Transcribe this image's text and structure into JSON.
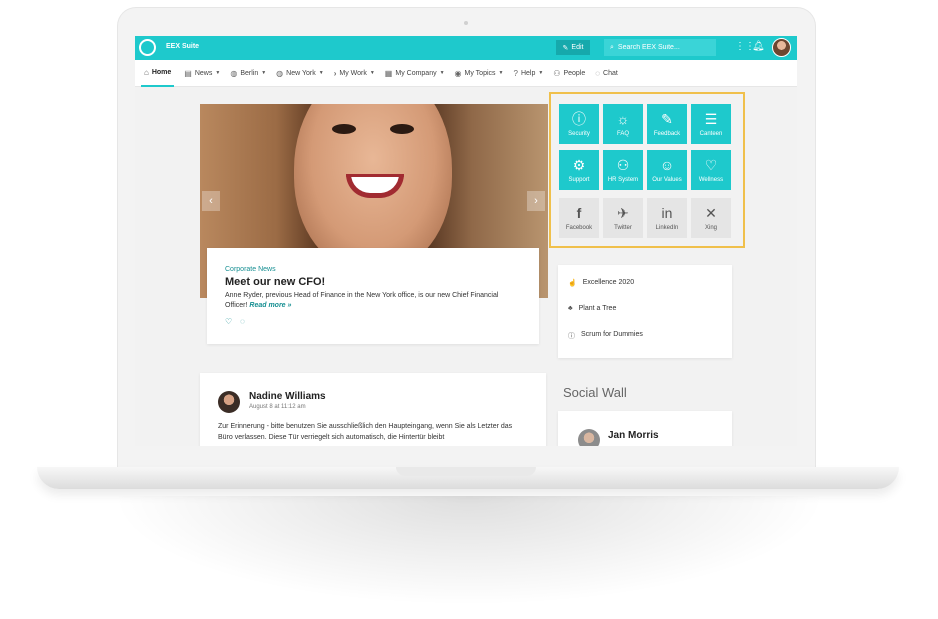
{
  "app": {
    "name": "EEX Suite"
  },
  "topbar": {
    "edit_label": "Edit",
    "search_placeholder": "Search EEX Suite..."
  },
  "nav": [
    {
      "label": "Home",
      "icon": "home-icon",
      "active": true
    },
    {
      "label": "News",
      "icon": "newspaper-icon",
      "dropdown": true
    },
    {
      "label": "Berlin",
      "icon": "location-pin-icon",
      "dropdown": true
    },
    {
      "label": "New York",
      "icon": "location-pin-icon",
      "dropdown": true
    },
    {
      "label": "My Work",
      "icon": "chevron-right-icon",
      "dropdown": true
    },
    {
      "label": "My Company",
      "icon": "building-icon",
      "dropdown": true
    },
    {
      "label": "My Topics",
      "icon": "eye-icon",
      "dropdown": true
    },
    {
      "label": "Help",
      "icon": "question-icon",
      "dropdown": true
    },
    {
      "label": "People",
      "icon": "people-icon"
    },
    {
      "label": "Chat",
      "icon": "chat-icon"
    }
  ],
  "hero": {
    "category": "Corporate News",
    "title": "Meet our new CFO!",
    "text": "Anne Ryder, previous Head of Finance in the New York office, is our new Chief Financial Officer!",
    "read_more": "Read more »"
  },
  "tiles": [
    {
      "label": "Security",
      "icon": "info-icon",
      "color": "#1ec9cc"
    },
    {
      "label": "FAQ",
      "icon": "lightbulb-icon",
      "color": "#1ec9cc"
    },
    {
      "label": "Feedback",
      "icon": "edit-icon",
      "color": "#1ec9cc"
    },
    {
      "label": "Canteen",
      "icon": "burger-icon",
      "color": "#1ec9cc"
    },
    {
      "label": "Support",
      "icon": "gear-icon",
      "color": "#1ec9cc"
    },
    {
      "label": "HR System",
      "icon": "team-icon",
      "color": "#1ec9cc"
    },
    {
      "label": "Our Values",
      "icon": "smile-icon",
      "color": "#1ec9cc"
    },
    {
      "label": "Wellness",
      "icon": "heart-icon",
      "color": "#1ec9cc"
    },
    {
      "label": "Facebook",
      "icon": "facebook-icon",
      "color": "#e5e5e5"
    },
    {
      "label": "Twitter",
      "icon": "twitter-icon",
      "color": "#e5e5e5"
    },
    {
      "label": "LinkedIn",
      "icon": "linkedin-icon",
      "color": "#e5e5e5"
    },
    {
      "label": "Xing",
      "icon": "xing-icon",
      "color": "#e5e5e5"
    }
  ],
  "quick_links": [
    {
      "label": "Excellence 2020",
      "icon": "thumbs-up-icon"
    },
    {
      "label": "Plant a Tree",
      "icon": "tree-icon"
    },
    {
      "label": "Scrum for Dummies",
      "icon": "info-icon"
    }
  ],
  "post": {
    "author": "Nadine Williams",
    "date": "August 8 at 11:12 am",
    "text": "Zur Erinnerung - bitte benutzen Sie ausschließlich den Haupteingang, wenn Sie als Letzter das Büro verlassen. Diese Tür verriegelt sich automatisch, die Hintertür bleibt"
  },
  "social_wall": {
    "title": "Social Wall",
    "first_post_author": "Jan Morris"
  },
  "colors": {
    "accent": "#1ec9cc",
    "highlight_frame": "#f0c04b"
  }
}
